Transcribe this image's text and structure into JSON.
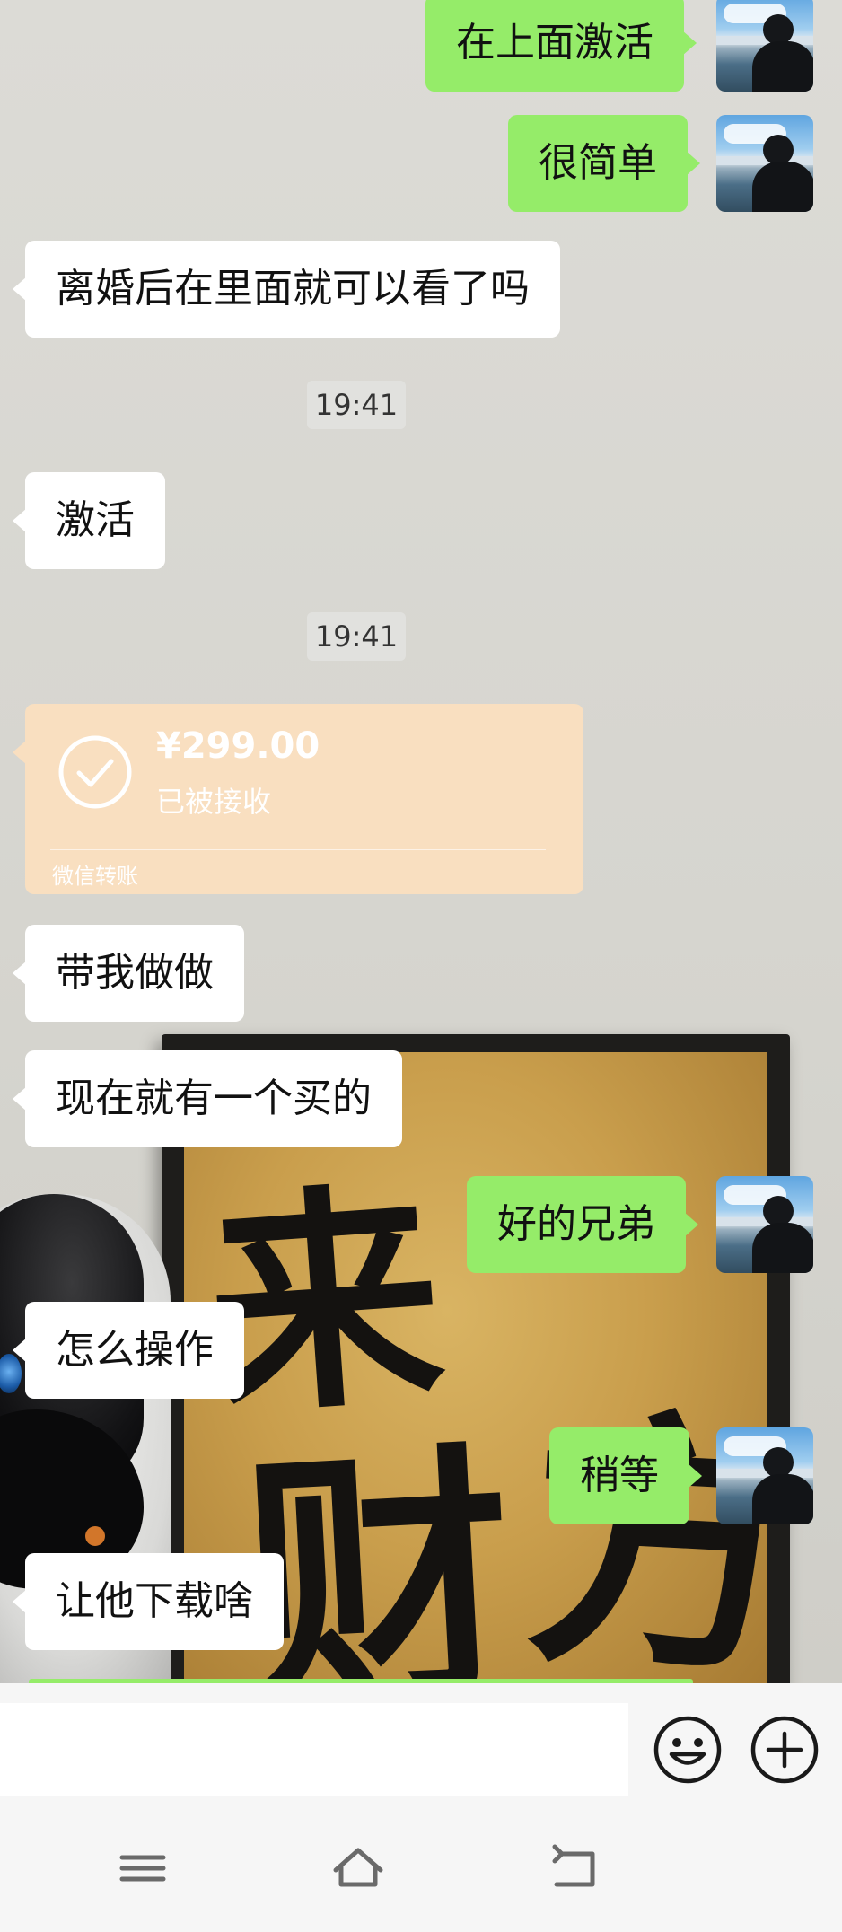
{
  "messages": [
    {
      "side": "out",
      "text": "在上面激活"
    },
    {
      "side": "out",
      "text": "很简单"
    },
    {
      "side": "in",
      "text": "离婚后在里面就可以看了吗"
    },
    {
      "side": "in",
      "text": "激活"
    },
    {
      "side": "in",
      "text": "带我做做"
    },
    {
      "side": "in",
      "text": "现在就有一个买的"
    },
    {
      "side": "out",
      "text": "好的兄弟"
    },
    {
      "side": "in",
      "text": "怎么操作"
    },
    {
      "side": "out",
      "text": "稍等"
    },
    {
      "side": "in",
      "text": "让他下载啥"
    }
  ],
  "timestamps": [
    "19:41",
    "19:41"
  ],
  "transfer": {
    "amount": "¥299.00",
    "status": "已被接收",
    "footer": "微信转账"
  },
  "wallpaper": {
    "calligraphy": [
      "来",
      "财",
      "方"
    ]
  },
  "input": {
    "value": "",
    "placeholder": ""
  },
  "icons": {
    "emoji": "smiley-face-icon",
    "plus": "plus-circle-icon",
    "nav_menu": "menu-icon",
    "nav_home": "home-icon",
    "nav_back": "back-icon"
  },
  "colors": {
    "incoming_bubble": "#ffffff",
    "outgoing_bubble": "#95ec69",
    "transfer_card": "#f9dfc0",
    "chat_background": "#d9d8d3"
  }
}
